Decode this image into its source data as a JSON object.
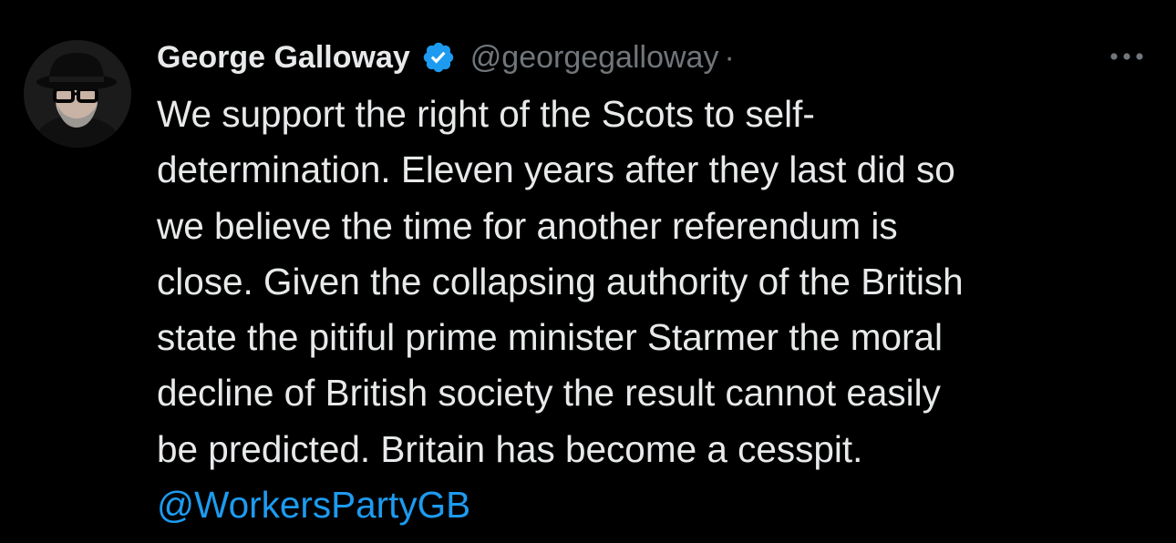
{
  "author": {
    "display_name": "George Galloway",
    "verified_icon": "verified-badge-icon",
    "handle": "@georgegalloway",
    "separator": "·",
    "avatar_icon": "profile-photo"
  },
  "more_icon": "more-options-icon",
  "tweet": {
    "lines": [
      "We support the right of the Scots to self-",
      "determination. Eleven years after they last did so",
      "we believe the time for another referendum is",
      "close. Given the collapsing authority of the British",
      "state the pitiful prime minister Starmer the moral",
      "decline of British society the result cannot easily",
      "be predicted. Britain has become a cesspit."
    ],
    "mention": "@WorkersPartyGB"
  },
  "colors": {
    "background": "#000000",
    "text": "#e7e9ea",
    "muted": "#71767b",
    "link": "#1d9bf0"
  }
}
